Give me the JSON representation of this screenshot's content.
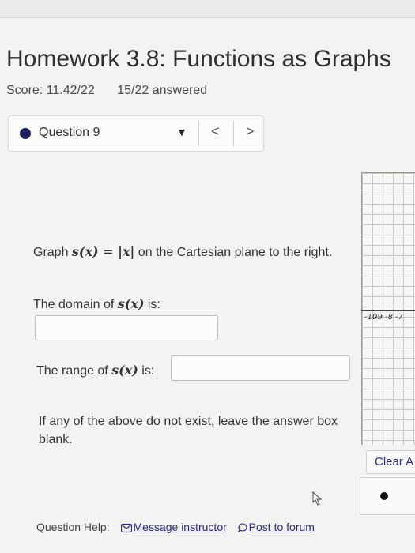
{
  "header": {
    "title": "Homework 3.8: Functions as Graphs",
    "score": "Score: 11.42/22",
    "answered": "15/22 answered"
  },
  "question_nav": {
    "label": "Question 9",
    "caret": "▼",
    "prev": "<",
    "next": ">"
  },
  "prompt": {
    "text_before": "Graph ",
    "func": "s(x) = |x|",
    "text_after": " on the Cartesian plane to the right."
  },
  "domain": {
    "label_before": "The domain of ",
    "func": "s(x)",
    "label_after": " is:",
    "value": ""
  },
  "range": {
    "label_before": "The range of ",
    "func": "s(x)",
    "label_after": " is:",
    "value": ""
  },
  "note": "If any of the above do not exist, leave the answer box blank.",
  "graph": {
    "tick_labels": [
      "-10",
      "-9",
      "-8",
      "-7"
    ],
    "clear_label": "Clear A"
  },
  "help": {
    "label": "Question Help:",
    "message_link": "Message instructor",
    "forum_link": "Post to forum"
  },
  "colors": {
    "accent": "#1c1f5c",
    "link": "#2a2a7a"
  }
}
